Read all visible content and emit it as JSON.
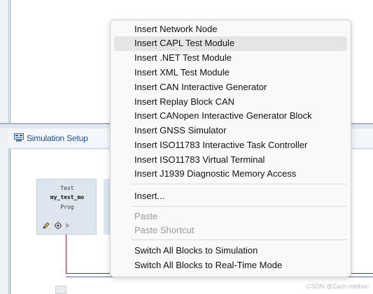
{
  "simulation_setup": {
    "title": "Simulation Setup",
    "icon": "simulation-setup-icon"
  },
  "test_block": {
    "line1": "Test",
    "line2": "my_test_mo",
    "line3": "Prog",
    "icons": [
      "pencil-icon",
      "gear-icon",
      "play-icon"
    ]
  },
  "context_menu": {
    "insert_items": [
      "Insert Network Node",
      "Insert CAPL Test Module",
      "Insert .NET Test Module",
      "Insert XML Test Module",
      "Insert CAN Interactive Generator",
      "Insert Replay Block CAN",
      "Insert CANopen Interactive Generator Block",
      "Insert GNSS Simulator",
      "Insert ISO11783 Interactive Task Controller",
      "Insert ISO11783 Virtual Terminal",
      "Insert J1939 Diagnostic Memory Access"
    ],
    "insert_more": "Insert...",
    "paste": "Paste",
    "paste_shortcut": "Paste Shortcut",
    "switch_sim": "Switch All Blocks to Simulation",
    "switch_rt": "Switch All Blocks to Real-Time Mode",
    "highlighted_item": "Insert CAPL Test Module"
  },
  "watermark": "CSDN @Zach methoc",
  "colors": {
    "title_text": "#1f4e9c",
    "connection_line": "#9a1e3d",
    "menu_highlight": "#e5e5e5",
    "disabled_text": "#9a9a9a"
  }
}
